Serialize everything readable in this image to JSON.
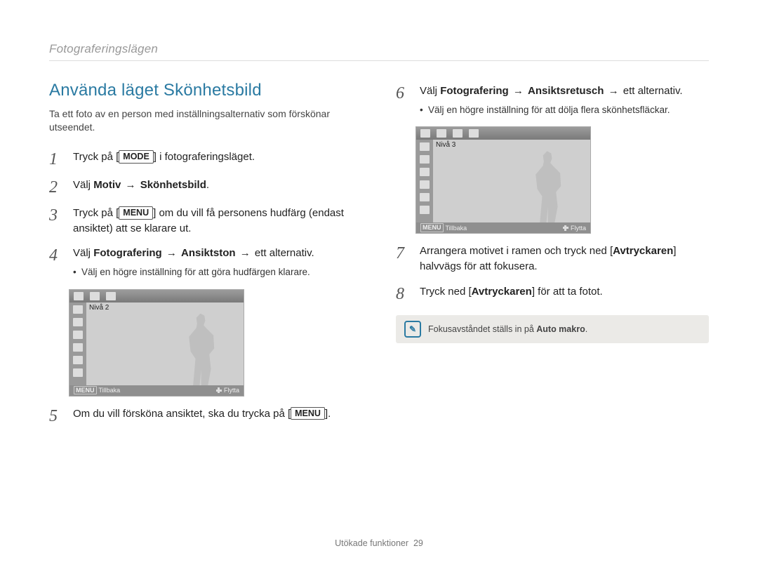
{
  "breadcrumb": "Fotograferingslägen",
  "title": "Använda läget Skönhetsbild",
  "intro": "Ta ett foto av en person med inställningsalternativ som förskönar utseendet.",
  "steps": {
    "s1": {
      "pre": "Tryck på [",
      "key": "MODE",
      "post": "] i fotograferingsläget."
    },
    "s2": {
      "pre": "Välj ",
      "b1": "Motiv",
      "arrow": " → ",
      "b2": "Skönhetsbild",
      "post": "."
    },
    "s3": {
      "pre": "Tryck på [",
      "key": "MENU",
      "post": "] om du vill få personens hudfärg (endast ansiktet) att se klarare ut."
    },
    "s4": {
      "pre": "Välj ",
      "b1": "Fotografering",
      "arrow1": " → ",
      "b2": "Ansiktston",
      "arrow2": " → ",
      "tail": "ett alternativ.",
      "sub": "Välj en högre inställning för att göra hudfärgen klarare."
    },
    "s5": {
      "pre": "Om du vill försköna ansiktet, ska du trycka på [",
      "key": "MENU",
      "post": "]."
    },
    "s6": {
      "pre": "Välj ",
      "b1": "Fotografering",
      "arrow1": " → ",
      "b2": "Ansiktsretusch",
      "arrow2": " → ",
      "tail": "ett alternativ.",
      "sub": "Välj en högre inställning för att dölja flera skönhetsfläckar."
    },
    "s7": {
      "pre": "Arrangera motivet i ramen och tryck ned [",
      "b": "Avtryckaren",
      "post": "] halvvägs för att fokusera."
    },
    "s8": {
      "pre": "Tryck ned [",
      "b": "Avtryckaren",
      "post": "] för att ta fotot."
    }
  },
  "lcd": {
    "level2": "Nivå 2",
    "level3": "Nivå 3",
    "menu_key": "MENU",
    "back": "Tillbaka",
    "move": "Flytta"
  },
  "note": {
    "pre": "Fokusavståndet ställs in på ",
    "b": "Auto makro",
    "post": "."
  },
  "footer": {
    "label": "Utökade funktioner",
    "page": "29"
  }
}
